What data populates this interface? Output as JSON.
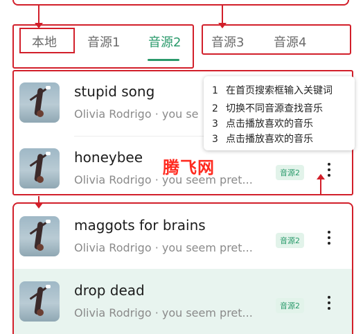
{
  "tabs": {
    "local": "本地",
    "source1": "音源1",
    "source2": "音源2",
    "source3": "音源3",
    "source4": "音源4",
    "active": "音源2"
  },
  "songs": [
    {
      "title": "stupid song",
      "subtitle": "Olivia Rodrigo · you se",
      "badge": "",
      "highlighted": false
    },
    {
      "title": "honeybee",
      "subtitle": "Olivia Rodrigo · you seem pret...",
      "badge": "音源2",
      "highlighted": false
    },
    {
      "title": "maggots for brains",
      "subtitle": "Olivia Rodrigo · you seem pret...",
      "badge": "音源2",
      "highlighted": false
    },
    {
      "title": "drop dead",
      "subtitle": "Olivia Rodrigo · you seem pret...",
      "badge": "音源2",
      "highlighted": true
    }
  ],
  "tooltip": {
    "steps": [
      {
        "num": "1",
        "text": "在首页搜索框输入关键词"
      },
      {
        "num": "2",
        "text": "切换不同音源查找音乐"
      },
      {
        "num": "3",
        "text": "点击播放喜欢的音乐"
      },
      {
        "num": "3",
        "text": "点击播放喜欢的音乐"
      }
    ]
  },
  "watermark": "腾飞网",
  "icons": {
    "more": "more-vertical-icon",
    "cover": "album-cover"
  },
  "colors": {
    "accent": "#2a9a6b",
    "annotation": "#d21f2a",
    "highlight_row": "#e8f4ef",
    "watermark": "#ff2a1f"
  }
}
